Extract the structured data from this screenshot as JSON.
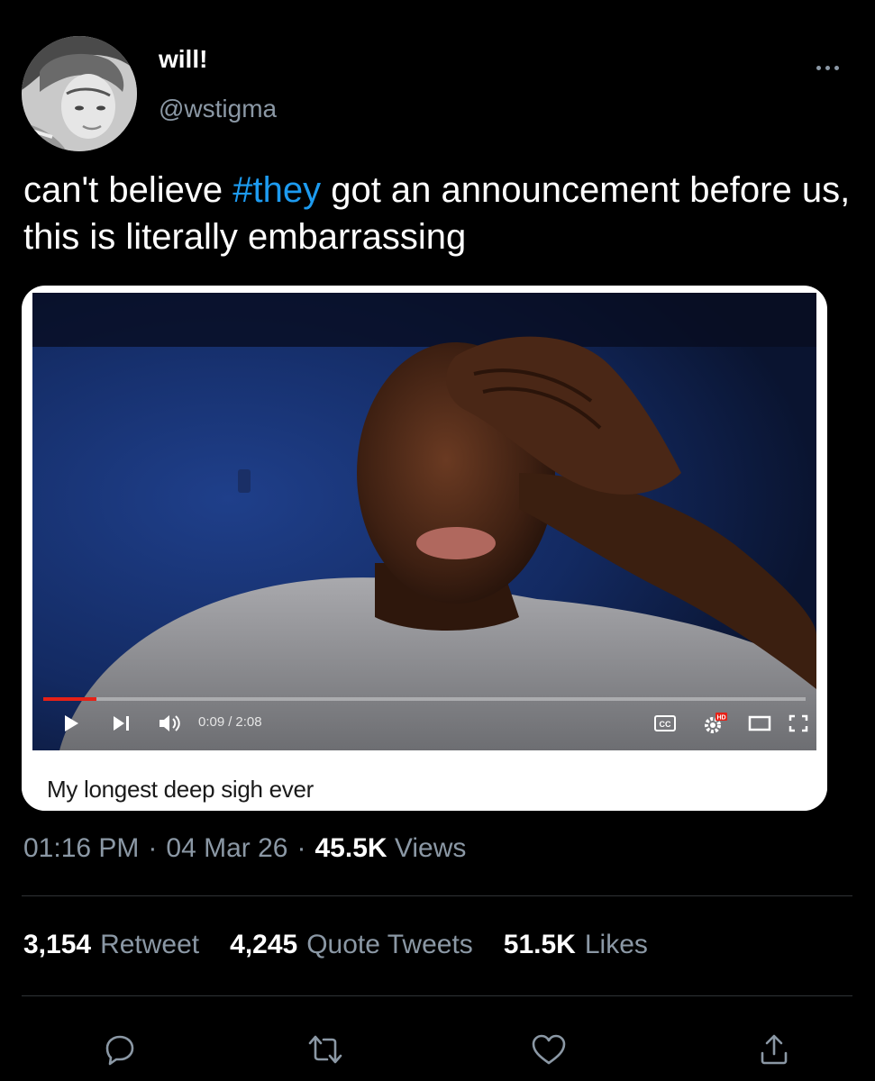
{
  "author": {
    "display_name": "will!",
    "handle": "@wstigma"
  },
  "tweet": {
    "text_before": "can't believe ",
    "hashtag": "#they",
    "text_after": " got an announcement before us, this is literally embarrassing"
  },
  "video": {
    "current_time": "0:09",
    "duration": "2:08",
    "time_separator": "/",
    "progress_fraction": 0.07,
    "caption": "My longest deep sigh ever",
    "cc_label": "CC",
    "hd_badge": "HD"
  },
  "meta": {
    "time": "01:16 PM",
    "separator": "·",
    "date": "04 Mar 26",
    "views_count": "45.5K",
    "views_label": "Views"
  },
  "stats": {
    "retweets_count": "3,154",
    "retweets_label": "Retweet",
    "quotes_count": "4,245",
    "quotes_label": "Quote Tweets",
    "likes_count": "51.5K",
    "likes_label": "Likes"
  },
  "icons": {
    "more": "more-horizontal-icon",
    "reply": "reply-icon",
    "retweet": "retweet-icon",
    "like": "heart-icon",
    "share": "share-icon",
    "play": "play-icon",
    "next": "next-icon",
    "volume": "volume-icon",
    "cc": "cc-icon",
    "settings": "settings-gear-icon",
    "theater": "theater-mode-icon",
    "fullscreen": "fullscreen-icon"
  },
  "colors": {
    "background": "#000000",
    "text_primary": "#ffffff",
    "text_secondary": "#8b98a5",
    "link": "#1d9bf0",
    "divider": "#2f3336",
    "progress": "#e62117"
  }
}
